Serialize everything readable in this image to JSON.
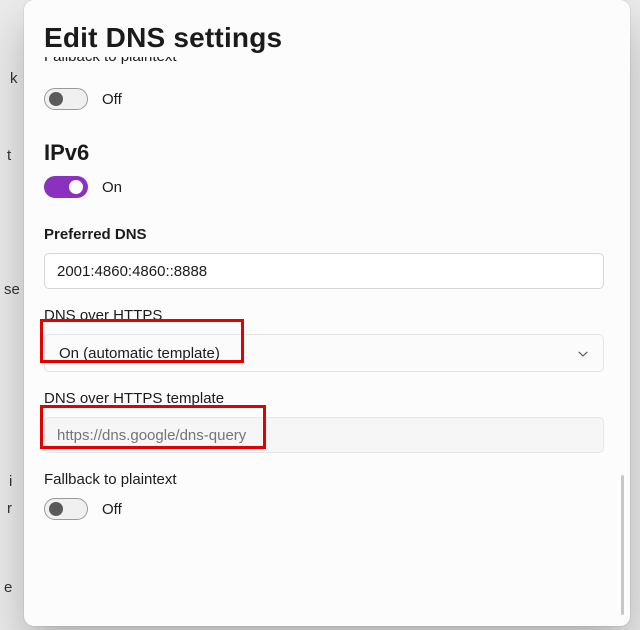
{
  "dialog": {
    "title": "Edit DNS settings"
  },
  "fallback_top": {
    "label_cut": "Fallback to plaintext",
    "state_text": "Off",
    "on": false
  },
  "ipv6": {
    "heading": "IPv6",
    "state_text": "On",
    "on": true,
    "preferred_dns_label": "Preferred DNS",
    "preferred_dns_value": "2001:4860:4860::8888",
    "doh_label": "DNS over HTTPS",
    "doh_selected": "On (automatic template)",
    "doh_template_label": "DNS over HTTPS template",
    "doh_template_placeholder": "https://dns.google/dns-query",
    "fallback_label": "Fallback to plaintext",
    "fallback_state_text": "Off",
    "fallback_on": false
  },
  "colors": {
    "accent": "#8a31bf",
    "highlight_border": "#e20000"
  }
}
